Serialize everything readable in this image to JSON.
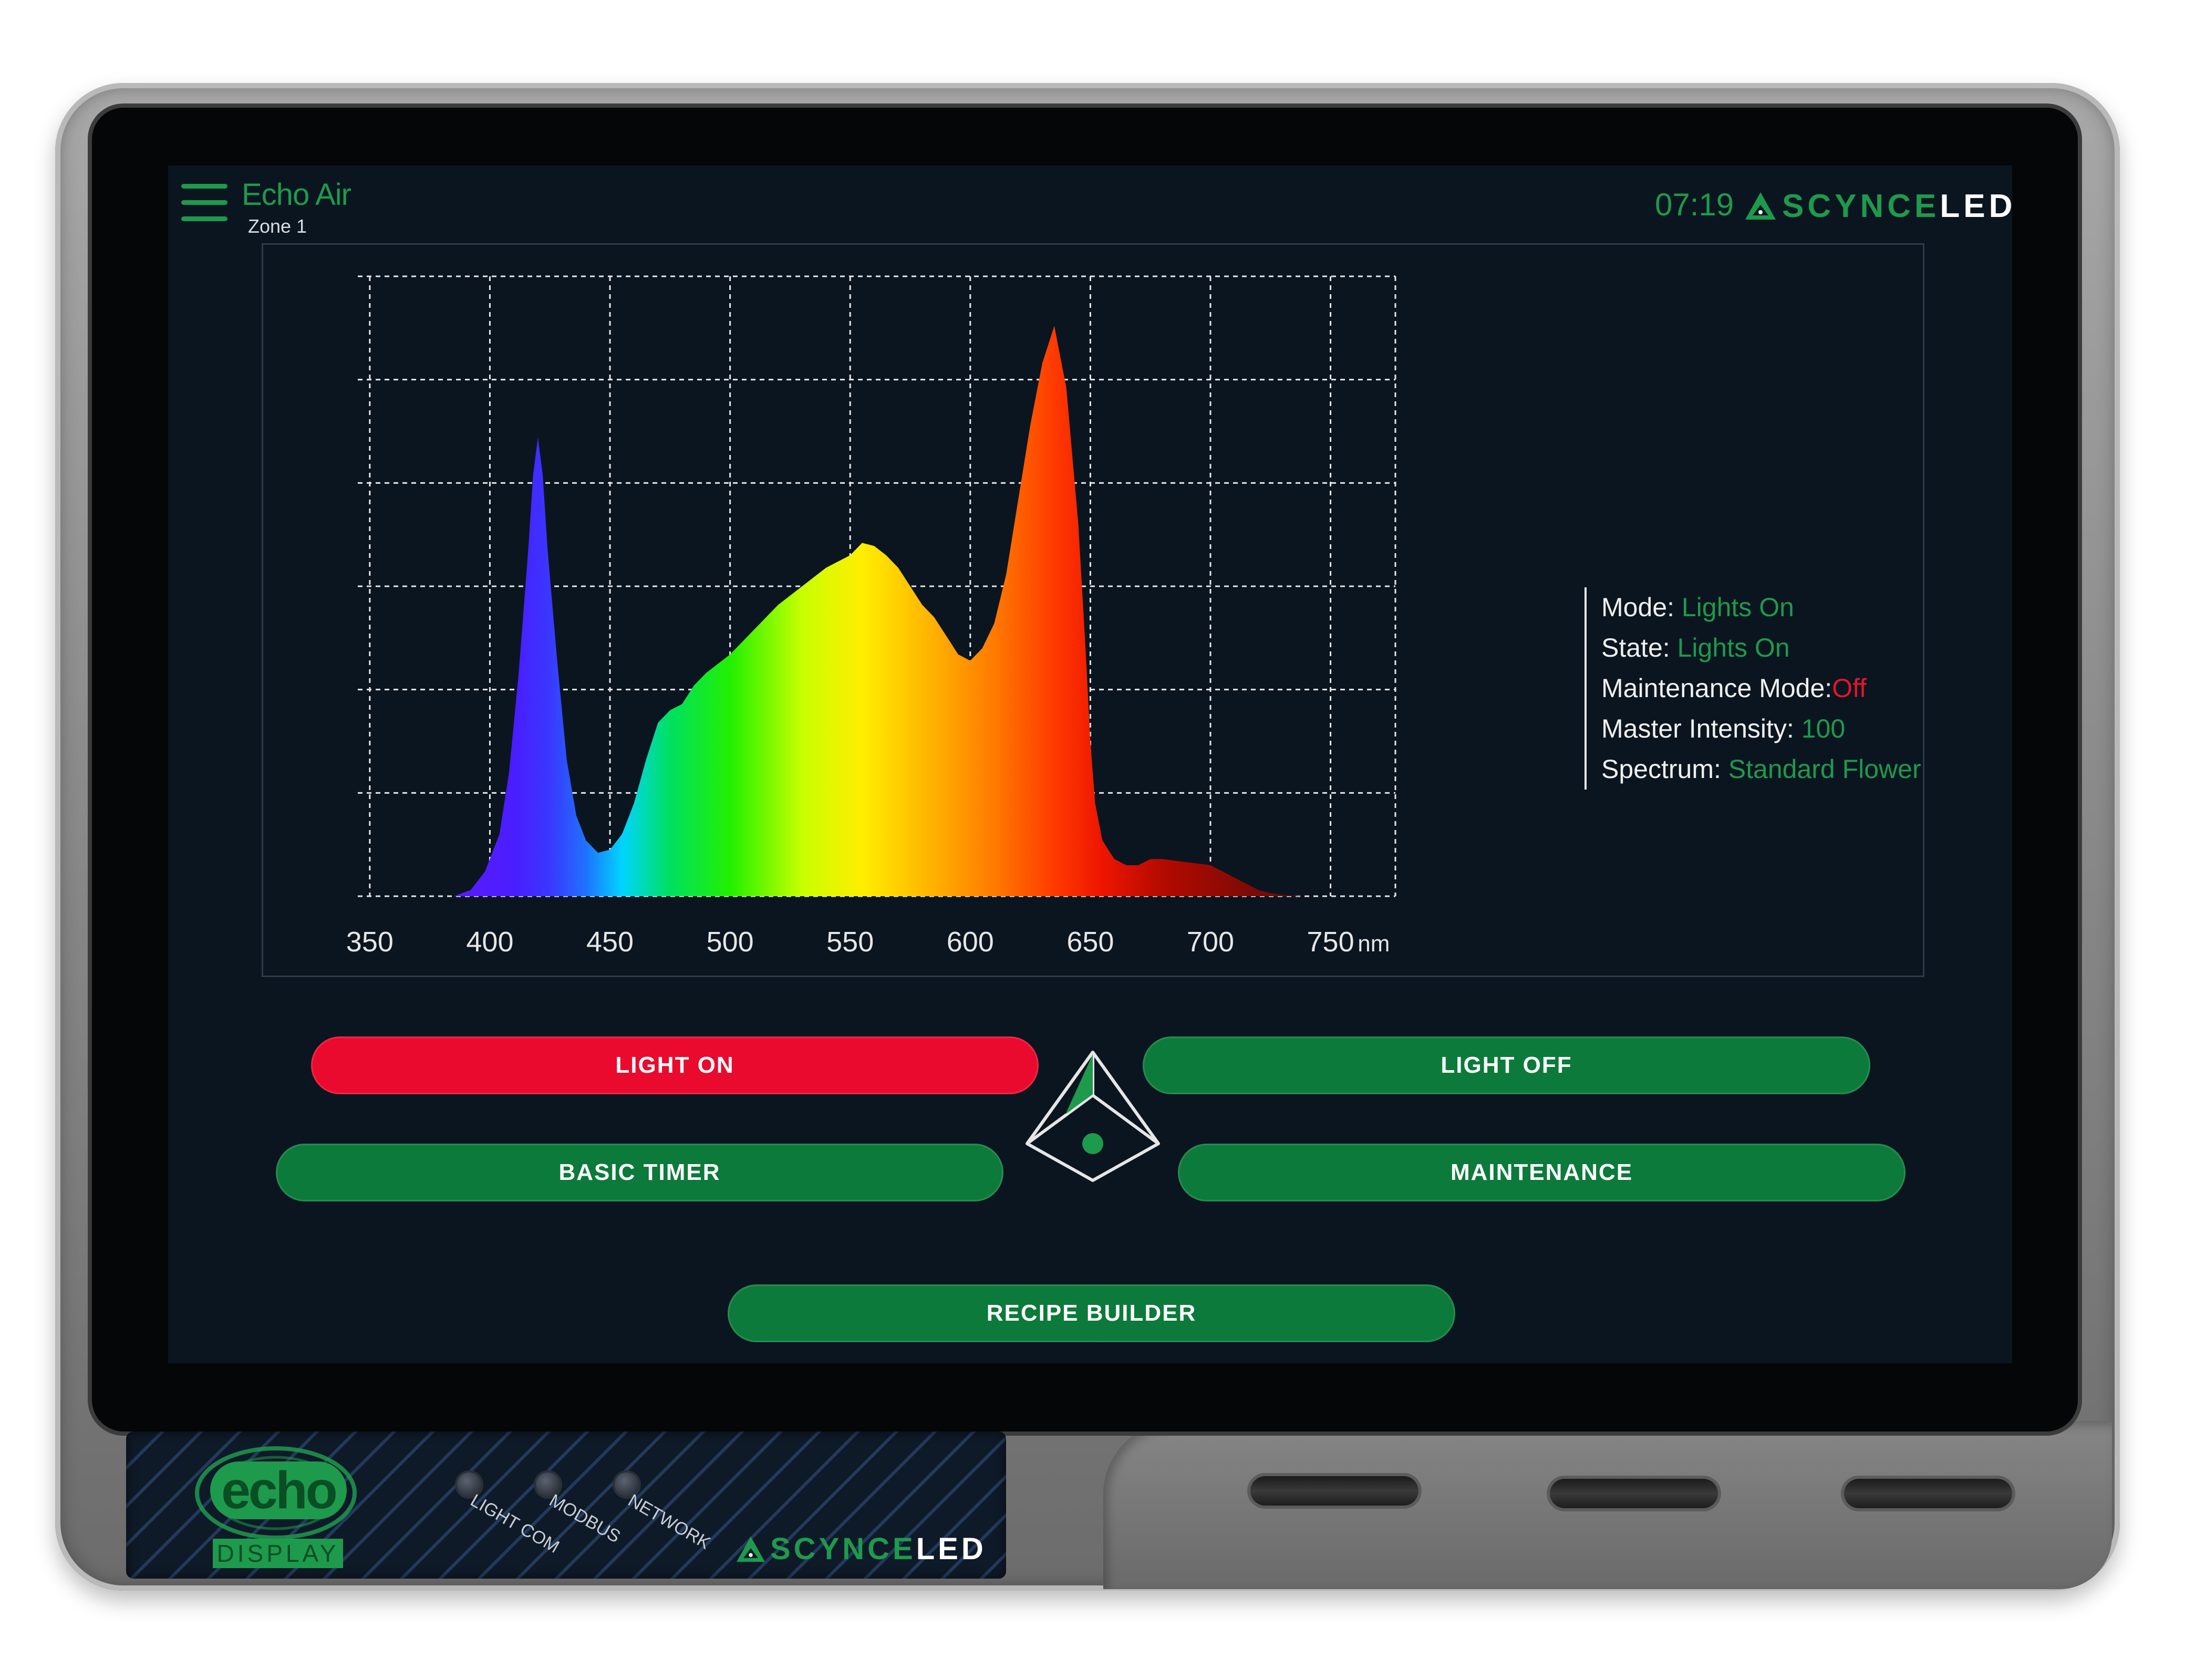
{
  "header": {
    "app_title": "Echo Air",
    "zone": "Zone 1",
    "time": "07:19",
    "brand_prefix": "SCYNCE",
    "brand_suffix": "LED"
  },
  "chart_data": {
    "type": "area",
    "xlabel": "",
    "x_unit_label": "nm",
    "ylabel": "",
    "x_ticks": [
      "350",
      "400",
      "450",
      "500",
      "550",
      "600",
      "650",
      "700",
      "750"
    ],
    "xlim": [
      345,
      777
    ],
    "ylim": [
      0,
      1.0
    ],
    "grid": true,
    "series": [
      {
        "x": [
          385,
          392,
          398,
          404,
          408,
          412,
          416,
          418,
          420,
          422,
          424,
          428,
          432,
          436,
          440,
          445,
          450,
          455,
          460,
          465,
          470,
          475,
          480,
          485,
          490,
          500,
          510,
          520,
          530,
          540,
          550,
          555,
          560,
          565,
          570,
          575,
          580,
          585,
          590,
          595,
          600,
          605,
          610,
          615,
          620,
          625,
          630,
          635,
          640,
          645,
          648,
          650,
          652,
          655,
          660,
          665,
          670,
          675,
          680,
          690,
          700,
          705,
          710,
          715,
          720,
          725,
          730,
          740,
          750,
          760,
          770
        ],
        "values": [
          0.0,
          0.01,
          0.04,
          0.1,
          0.2,
          0.36,
          0.56,
          0.68,
          0.74,
          0.68,
          0.56,
          0.38,
          0.22,
          0.13,
          0.09,
          0.07,
          0.075,
          0.1,
          0.15,
          0.22,
          0.28,
          0.3,
          0.31,
          0.34,
          0.36,
          0.39,
          0.43,
          0.47,
          0.5,
          0.53,
          0.55,
          0.57,
          0.565,
          0.55,
          0.53,
          0.5,
          0.47,
          0.45,
          0.42,
          0.39,
          0.38,
          0.4,
          0.44,
          0.52,
          0.64,
          0.76,
          0.86,
          0.92,
          0.82,
          0.6,
          0.4,
          0.25,
          0.15,
          0.09,
          0.06,
          0.05,
          0.05,
          0.06,
          0.06,
          0.055,
          0.05,
          0.04,
          0.03,
          0.02,
          0.01,
          0.005,
          0.002,
          0.0,
          0.0,
          0.0,
          0.0
        ]
      }
    ]
  },
  "status": {
    "mode_label": "Mode:",
    "mode_value": "Lights On",
    "state_label": "State:",
    "state_value": "Lights On",
    "maint_label": "Maintenance Mode:",
    "maint_value": "Off",
    "intensity_label": "Master Intensity:",
    "intensity_value": "100",
    "spectrum_label": "Spectrum:",
    "spectrum_value": "Standard Flower"
  },
  "buttons": {
    "light_on": "LIGHT ON",
    "light_off": "LIGHT OFF",
    "basic_timer": "BASIC TIMER",
    "maintenance": "MAINTENANCE",
    "recipe_builder": "RECIPE BUILDER"
  },
  "hardware": {
    "badge_word": "echo",
    "badge_sub": "DISPLAY",
    "led_light_com": "LIGHT COM",
    "led_modbus": "MODBUS",
    "led_network": "NETWORK",
    "brand_prefix": "SCYNCE",
    "brand_suffix": "LED"
  },
  "colors": {
    "accent_green": "#1e9a4c",
    "button_green": "#0c7a3a",
    "alert_red": "#ea0a2d",
    "screen_bg": "#0b1520"
  }
}
